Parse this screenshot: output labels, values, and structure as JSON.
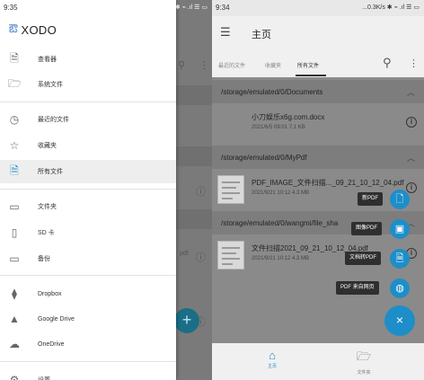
{
  "left": {
    "status": {
      "time": "9:35",
      "right": "...0.1K/s ✱ ⌁ .ıl ☰ ▭"
    },
    "drawer": {
      "brand": "XODO",
      "items": [
        {
          "label": "查看器",
          "icon": "file-icon"
        },
        {
          "label": "系统文件",
          "icon": "folder-open-icon"
        },
        {
          "label": "最近的文件",
          "icon": "clock-icon"
        },
        {
          "label": "收藏夹",
          "icon": "star-icon"
        },
        {
          "label": "所有文件",
          "icon": "document-icon"
        },
        {
          "label": "文件夹",
          "icon": "folder-icon"
        },
        {
          "label": "SD 卡",
          "icon": "sd-card-icon"
        },
        {
          "label": "备份",
          "icon": "folder-icon"
        },
        {
          "label": "Dropbox",
          "icon": "dropbox-icon"
        },
        {
          "label": "Google Drive",
          "icon": "google-drive-icon"
        },
        {
          "label": "OneDrive",
          "icon": "onedrive-icon"
        },
        {
          "label": "设置",
          "icon": "gear-icon"
        }
      ],
      "active_index": 4
    },
    "background_fab": "+",
    "background_fragment": "pdf"
  },
  "right": {
    "status": {
      "time": "9:34",
      "right": "...0.3K/s ✱ ⌁ .ıl ☰ ▭"
    },
    "appbar": {
      "title": "主页"
    },
    "tabs": [
      {
        "label": "最近的文件"
      },
      {
        "label": "收藏夹"
      },
      {
        "label": "所有文件"
      }
    ],
    "sections": [
      {
        "path": "/storage/emulated/0/Documents"
      },
      {
        "path": "/storage/emulated/0/MyPdf"
      },
      {
        "path": "/storage/emulated/0/wangmi/file_sha"
      }
    ],
    "files": [
      {
        "name": "小刀娱乐x6g.com.docx",
        "meta": "2021/6/5 09:01   7.1 KB"
      },
      {
        "name": "PDF_IMAGE_文件扫描..._09_21_10_12_04.pdf",
        "meta": "2021/9/21 10:12   4.3 MB"
      },
      {
        "name": "文件扫描2021_09_21_10_12_04.pdf",
        "meta": "2021/9/21 10:12   4.3 MB"
      }
    ],
    "actions": [
      {
        "label": "新PDF",
        "icon": "new-pdf-icon"
      },
      {
        "label": "图像PDF",
        "icon": "image-pdf-icon"
      },
      {
        "label": "文档转PDF",
        "icon": "doc-to-pdf-icon"
      },
      {
        "label": "PDF 来自网页",
        "icon": "globe-icon"
      }
    ],
    "fab_close": "×",
    "bottom_nav": [
      {
        "label": "主页",
        "icon": "home-icon"
      },
      {
        "label": "文件夹",
        "icon": "folder-icon"
      }
    ]
  },
  "colors": {
    "accent": "#1e8ec9",
    "scrim": "#8a8a8a",
    "drawer_bg": "#ffffff"
  }
}
